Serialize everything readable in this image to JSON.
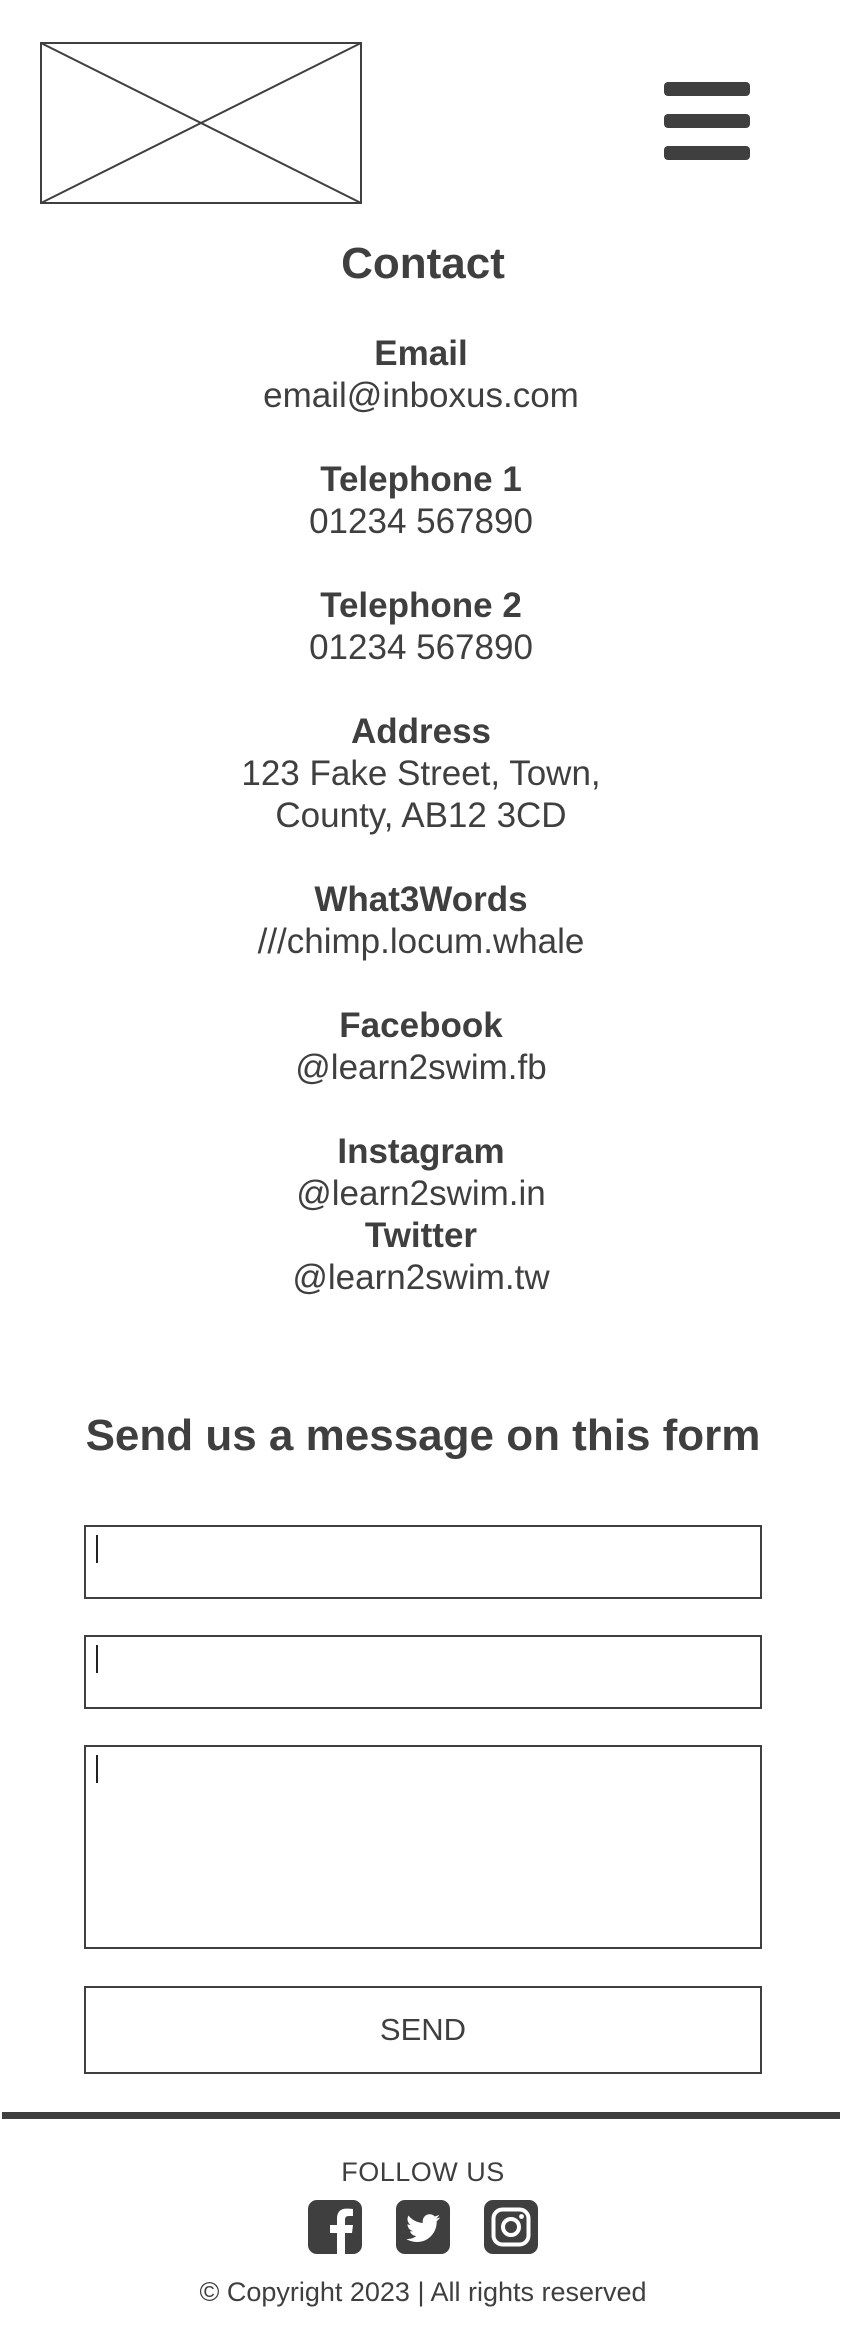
{
  "header": {
    "logo_icon": "image-placeholder-icon",
    "menu_icon": "hamburger-menu-icon"
  },
  "contact": {
    "title": "Contact",
    "email": {
      "label": "Email",
      "value": "email@inboxus.com"
    },
    "telephone_1": {
      "label": "Telephone 1",
      "value": "01234 567890"
    },
    "telephone_2": {
      "label": "Telephone 2",
      "value": "01234 567890"
    },
    "address": {
      "label": "Address",
      "line_1": "123 Fake Street, Town,",
      "line_2": "County, AB12 3CD"
    },
    "what3words": {
      "label": "What3Words",
      "value": "///chimp.locum.whale"
    },
    "facebook": {
      "label": "Facebook",
      "value": "@learn2swim.fb"
    },
    "instagram": {
      "label": "Instagram",
      "value": "@learn2swim.in"
    },
    "twitter": {
      "label": "Twitter",
      "value": "@learn2swim.tw"
    }
  },
  "form": {
    "heading": "Send us a message on this form",
    "send_label": "SEND"
  },
  "footer": {
    "follow_label": "FOLLOW US",
    "social_icons": [
      "facebook-icon",
      "twitter-icon",
      "instagram-icon"
    ],
    "copyright": "© Copyright 2023 | All rights reserved"
  },
  "colors": {
    "text": "#3f3f3f",
    "background": "#ffffff",
    "border": "#3f3f3f"
  }
}
